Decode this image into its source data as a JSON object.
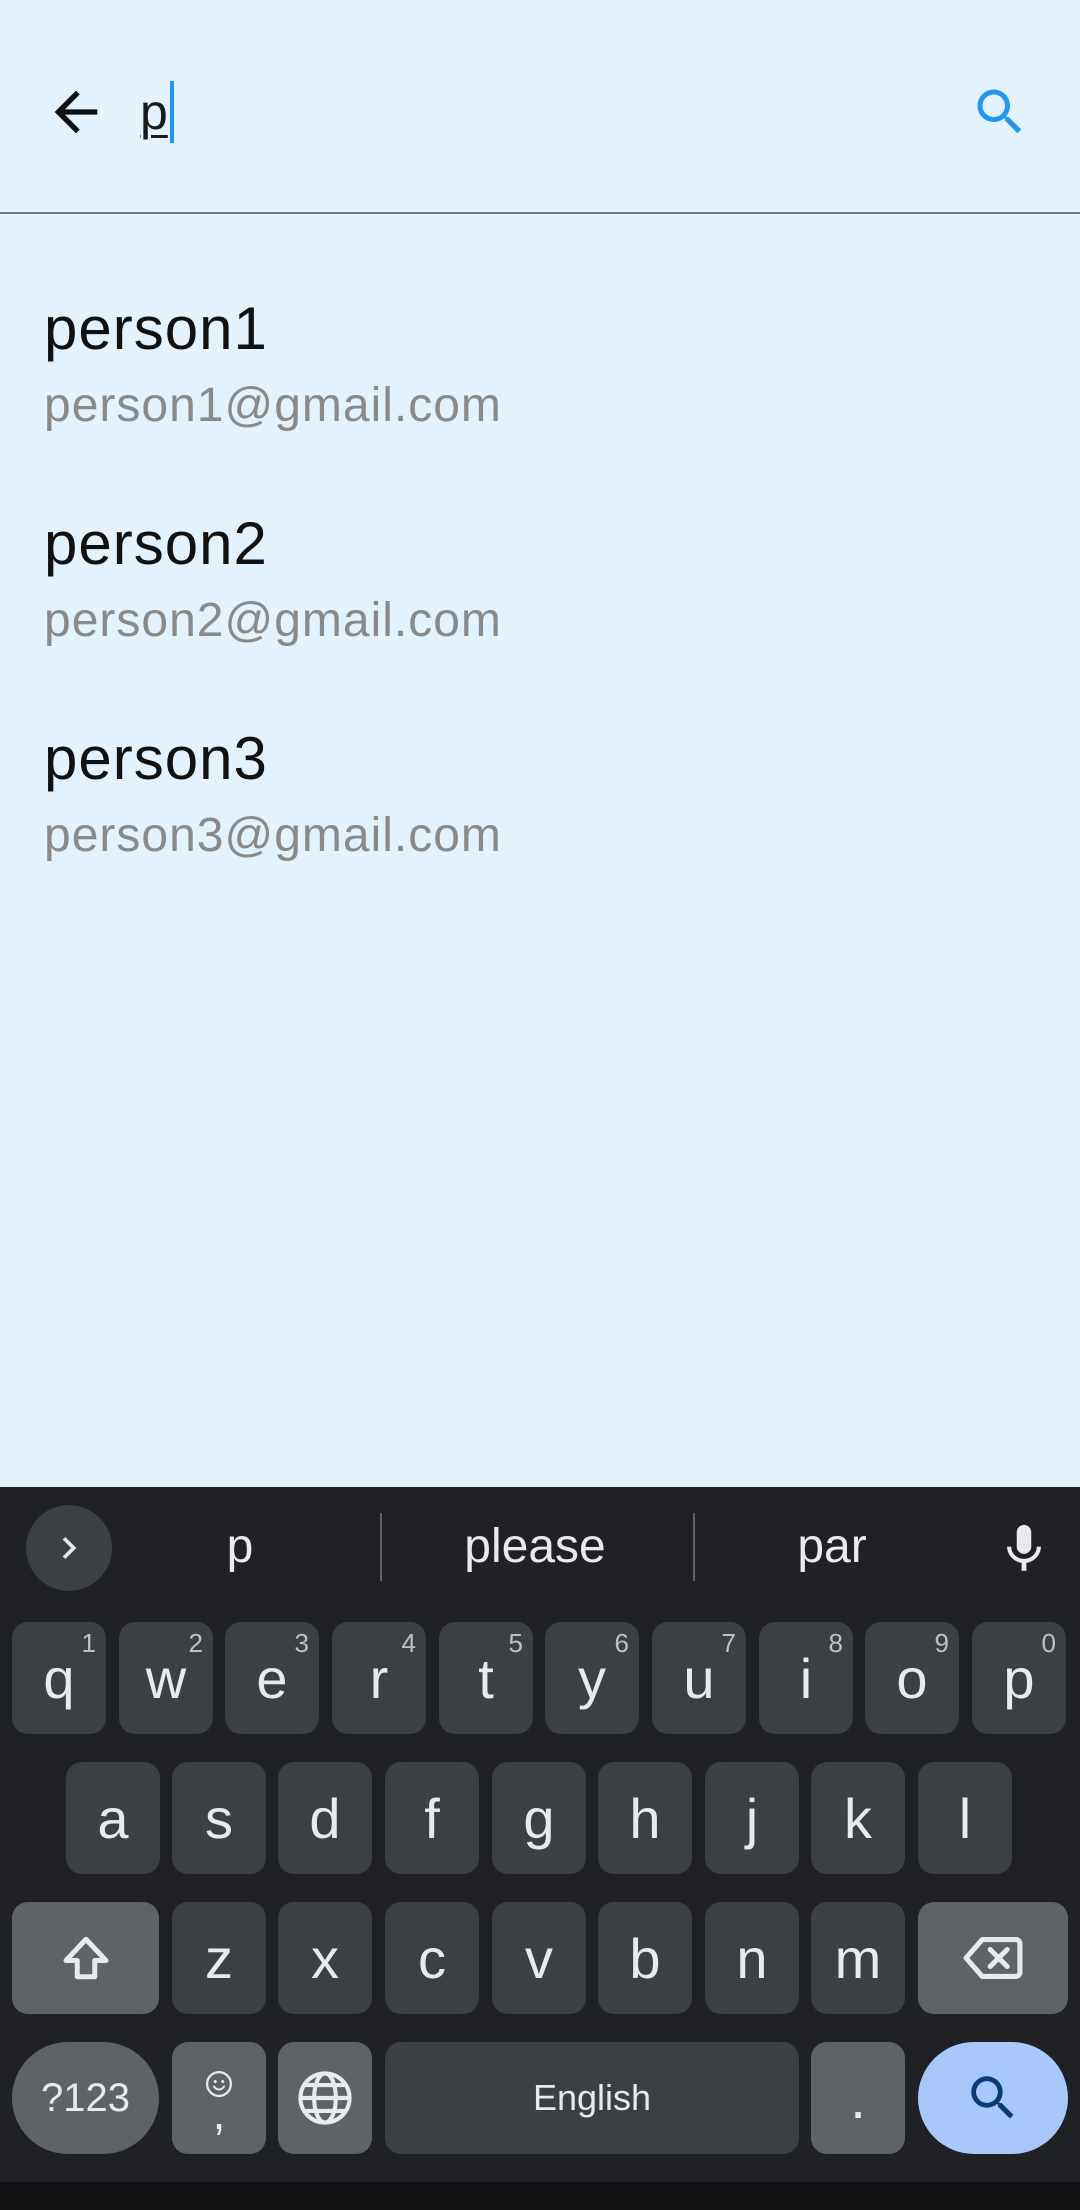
{
  "search": {
    "query": "p"
  },
  "results": [
    {
      "name": "person1",
      "email": "person1@gmail.com"
    },
    {
      "name": "person2",
      "email": "person2@gmail.com"
    },
    {
      "name": "person3",
      "email": "person3@gmail.com"
    }
  ],
  "keyboard": {
    "suggestions": [
      "p",
      "please",
      "par"
    ],
    "row1": [
      {
        "key": "q",
        "hint": "1"
      },
      {
        "key": "w",
        "hint": "2"
      },
      {
        "key": "e",
        "hint": "3"
      },
      {
        "key": "r",
        "hint": "4"
      },
      {
        "key": "t",
        "hint": "5"
      },
      {
        "key": "y",
        "hint": "6"
      },
      {
        "key": "u",
        "hint": "7"
      },
      {
        "key": "i",
        "hint": "8"
      },
      {
        "key": "o",
        "hint": "9"
      },
      {
        "key": "p",
        "hint": "0"
      }
    ],
    "row2": [
      "a",
      "s",
      "d",
      "f",
      "g",
      "h",
      "j",
      "k",
      "l"
    ],
    "row3": [
      "z",
      "x",
      "c",
      "v",
      "b",
      "n",
      "m"
    ],
    "symbols_label": "?123",
    "comma_label": ",",
    "space_label": "English",
    "period_label": "."
  },
  "colors": {
    "accent": "#2196f3",
    "background": "#e3f2fd",
    "keyboard_bg": "#202124",
    "key_bg": "#3c4043",
    "action_key": "#a8c7fa"
  }
}
